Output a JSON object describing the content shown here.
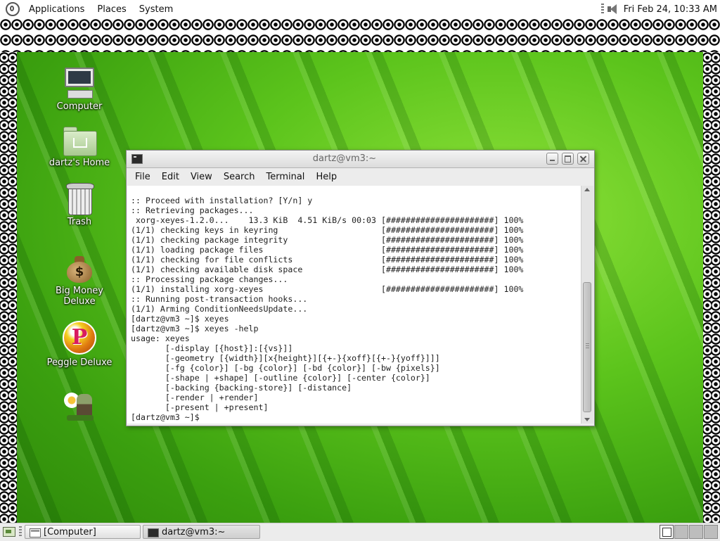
{
  "top_panel": {
    "menus": [
      "Applications",
      "Places",
      "System"
    ],
    "clock": "Fri Feb 24, 10:33 AM"
  },
  "desktop_icons": [
    {
      "label": "Computer",
      "icon": "computer-icon"
    },
    {
      "label": "dartz's Home",
      "icon": "home-folder-icon"
    },
    {
      "label": "Trash",
      "icon": "trash-icon"
    },
    {
      "label": "Big Money Deluxe",
      "icon": "money-bag-icon"
    },
    {
      "label": "Peggle Deluxe",
      "icon": "peggle-icon"
    },
    {
      "label": "",
      "icon": "plants-vs-zombies-icon"
    }
  ],
  "terminal": {
    "title": "dartz@vm3:~",
    "menu": [
      "File",
      "Edit",
      "View",
      "Search",
      "Terminal",
      "Help"
    ],
    "lines": [
      ":: Proceed with installation? [Y/n] y",
      ":: Retrieving packages...",
      " xorg-xeyes-1.2.0...    13.3 KiB  4.51 KiB/s 00:03 [######################] 100%",
      "(1/1) checking keys in keyring                     [######################] 100%",
      "(1/1) checking package integrity                   [######################] 100%",
      "(1/1) loading package files                        [######################] 100%",
      "(1/1) checking for file conflicts                  [######################] 100%",
      "(1/1) checking available disk space                [######################] 100%",
      ":: Processing package changes...",
      "(1/1) installing xorg-xeyes                        [######################] 100%",
      ":: Running post-transaction hooks...",
      "(1/1) Arming ConditionNeedsUpdate...",
      "[dartz@vm3 ~]$ xeyes",
      "[dartz@vm3 ~]$ xeyes -help",
      "usage: xeyes",
      "       [-display [{host}]:[{vs}]]",
      "       [-geometry [{width}][x{height}][{+-}{xoff}[{+-}{yoff}]]]",
      "       [-fg {color}] [-bg {color}] [-bd {color}] [-bw {pixels}]",
      "       [-shape | +shape] [-outline {color}] [-center {color}]",
      "       [-backing {backing-store}] [-distance]",
      "       [-render | +render]",
      "       [-present | +present]",
      "[dartz@vm3 ~]$ "
    ]
  },
  "taskbar": {
    "tasks": [
      "[Computer]",
      "dartz@vm3:~"
    ]
  }
}
